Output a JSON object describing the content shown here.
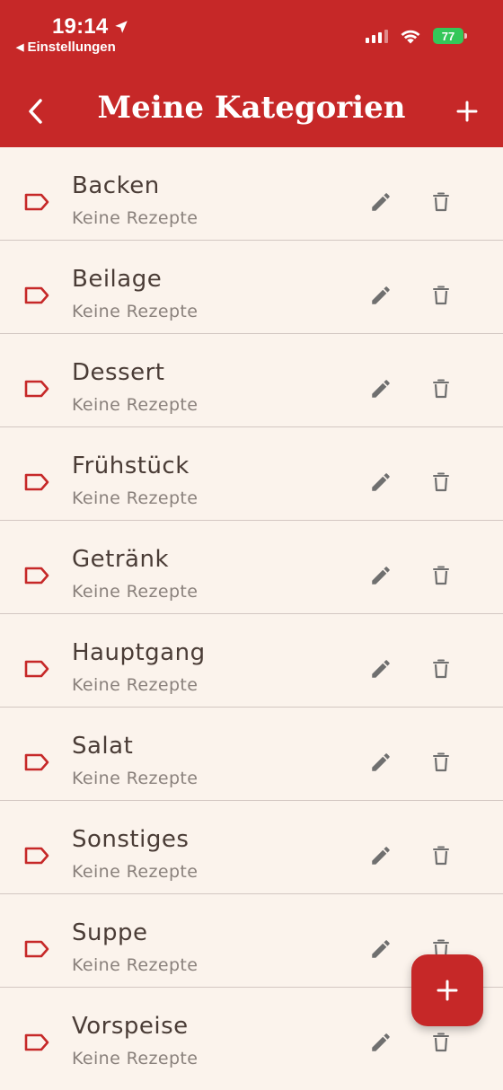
{
  "status_bar": {
    "time": "19:14",
    "back_app_label": "Einstellungen",
    "battery": "77"
  },
  "header": {
    "title": "Meine Kategorien"
  },
  "categories": [
    {
      "name": "Backen",
      "subtitle": "Keine Rezepte"
    },
    {
      "name": "Beilage",
      "subtitle": "Keine Rezepte"
    },
    {
      "name": "Dessert",
      "subtitle": "Keine Rezepte"
    },
    {
      "name": "Frühstück",
      "subtitle": "Keine Rezepte"
    },
    {
      "name": "Getränk",
      "subtitle": "Keine Rezepte"
    },
    {
      "name": "Hauptgang",
      "subtitle": "Keine Rezepte"
    },
    {
      "name": "Salat",
      "subtitle": "Keine Rezepte"
    },
    {
      "name": "Sonstiges",
      "subtitle": "Keine Rezepte"
    },
    {
      "name": "Suppe",
      "subtitle": "Keine Rezepte"
    },
    {
      "name": "Vorspeise",
      "subtitle": "Keine Rezepte"
    }
  ],
  "icons": {
    "category": "tag-icon",
    "edit": "pencil-icon",
    "delete": "trash-icon",
    "add": "plus-icon",
    "back": "chevron-left-icon"
  },
  "colors": {
    "brand": "#c62828",
    "background": "#fbf3ec",
    "icon_gray": "#6f6f6f"
  }
}
